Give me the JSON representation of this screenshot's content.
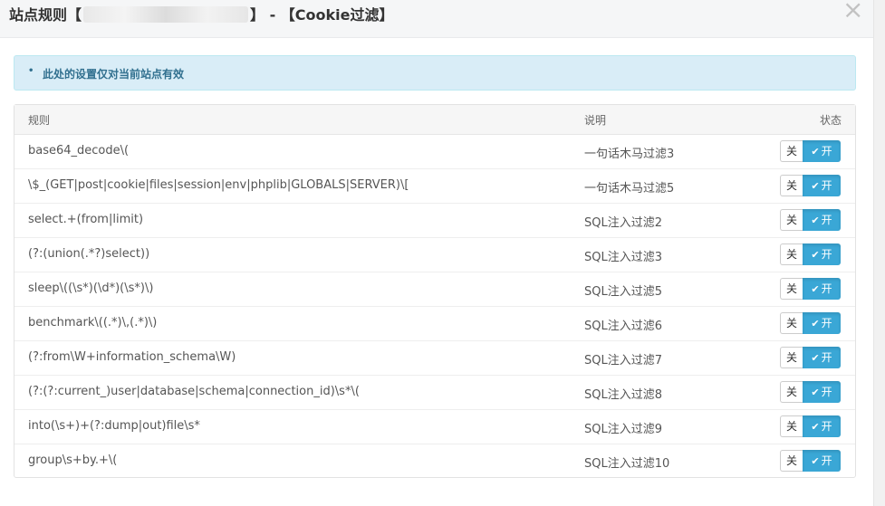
{
  "dialog": {
    "title_prefix": "站点规则【",
    "title_suffix": "】 - 【Cookie过滤】",
    "close_glyph": "×"
  },
  "notice": {
    "bullet": "•",
    "text": "此处的设置仅对当前站点有效"
  },
  "table": {
    "headers": {
      "rule": "规则",
      "desc": "说明",
      "status": "状态"
    },
    "toggle_off_label": "关",
    "toggle_on_label": "开",
    "toggle_check_glyph": "✔",
    "rows": [
      {
        "rule": "base64_decode\\(",
        "desc": "一句话木马过滤3",
        "enabled": true
      },
      {
        "rule": "\\$_(GET|post|cookie|files|session|env|phplib|GLOBALS|SERVER)\\[",
        "desc": "一句话木马过滤5",
        "enabled": true
      },
      {
        "rule": "select.+(from|limit)",
        "desc": "SQL注入过滤2",
        "enabled": true
      },
      {
        "rule": "(?:(union(.*?)select))",
        "desc": "SQL注入过滤3",
        "enabled": true
      },
      {
        "rule": "sleep\\((\\s*)(\\d*)(\\s*)\\)",
        "desc": "SQL注入过滤5",
        "enabled": true
      },
      {
        "rule": "benchmark\\((.*)\\,(.*)\\)",
        "desc": "SQL注入过滤6",
        "enabled": true
      },
      {
        "rule": "(?:from\\W+information_schema\\W)",
        "desc": "SQL注入过滤7",
        "enabled": true
      },
      {
        "rule": "(?:(?:current_)user|database|schema|connection_id)\\s*\\(",
        "desc": "SQL注入过滤8",
        "enabled": true
      },
      {
        "rule": "into(\\s+)+(?:dump|out)file\\s*",
        "desc": "SQL注入过滤9",
        "enabled": true
      },
      {
        "rule": "group\\s+by.+\\(",
        "desc": "SQL注入过滤10",
        "enabled": true
      }
    ]
  },
  "colors": {
    "toggle_on": "#3aa7d6",
    "notice_bg": "#d9edf7",
    "notice_text": "#31708f"
  }
}
